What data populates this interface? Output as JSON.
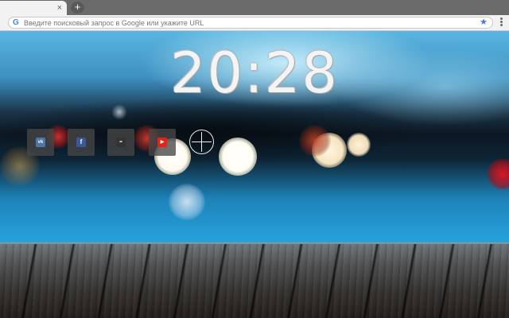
{
  "browser": {
    "tab": {
      "close_glyph": "×"
    },
    "new_tab_glyph": "+",
    "omnibox": {
      "placeholder": "Введите поисковый запрос в Google или укажите URL",
      "g_glyph": "G",
      "star_glyph": "★"
    }
  },
  "clock": {
    "time": "20:28"
  },
  "speed_dial": {
    "tiles": [
      {
        "name": "vk",
        "glyph": "vk",
        "color": "#4a76a8"
      },
      {
        "name": "facebook",
        "glyph": "f",
        "color": "#3b5998"
      },
      {
        "name": "site",
        "glyph": "◓",
        "color": "#333333"
      },
      {
        "name": "youtube",
        "glyph": "▶",
        "color": "#e62117"
      }
    ]
  },
  "colors": {
    "accent": "#4285f4",
    "star": "#3b7ddd"
  }
}
